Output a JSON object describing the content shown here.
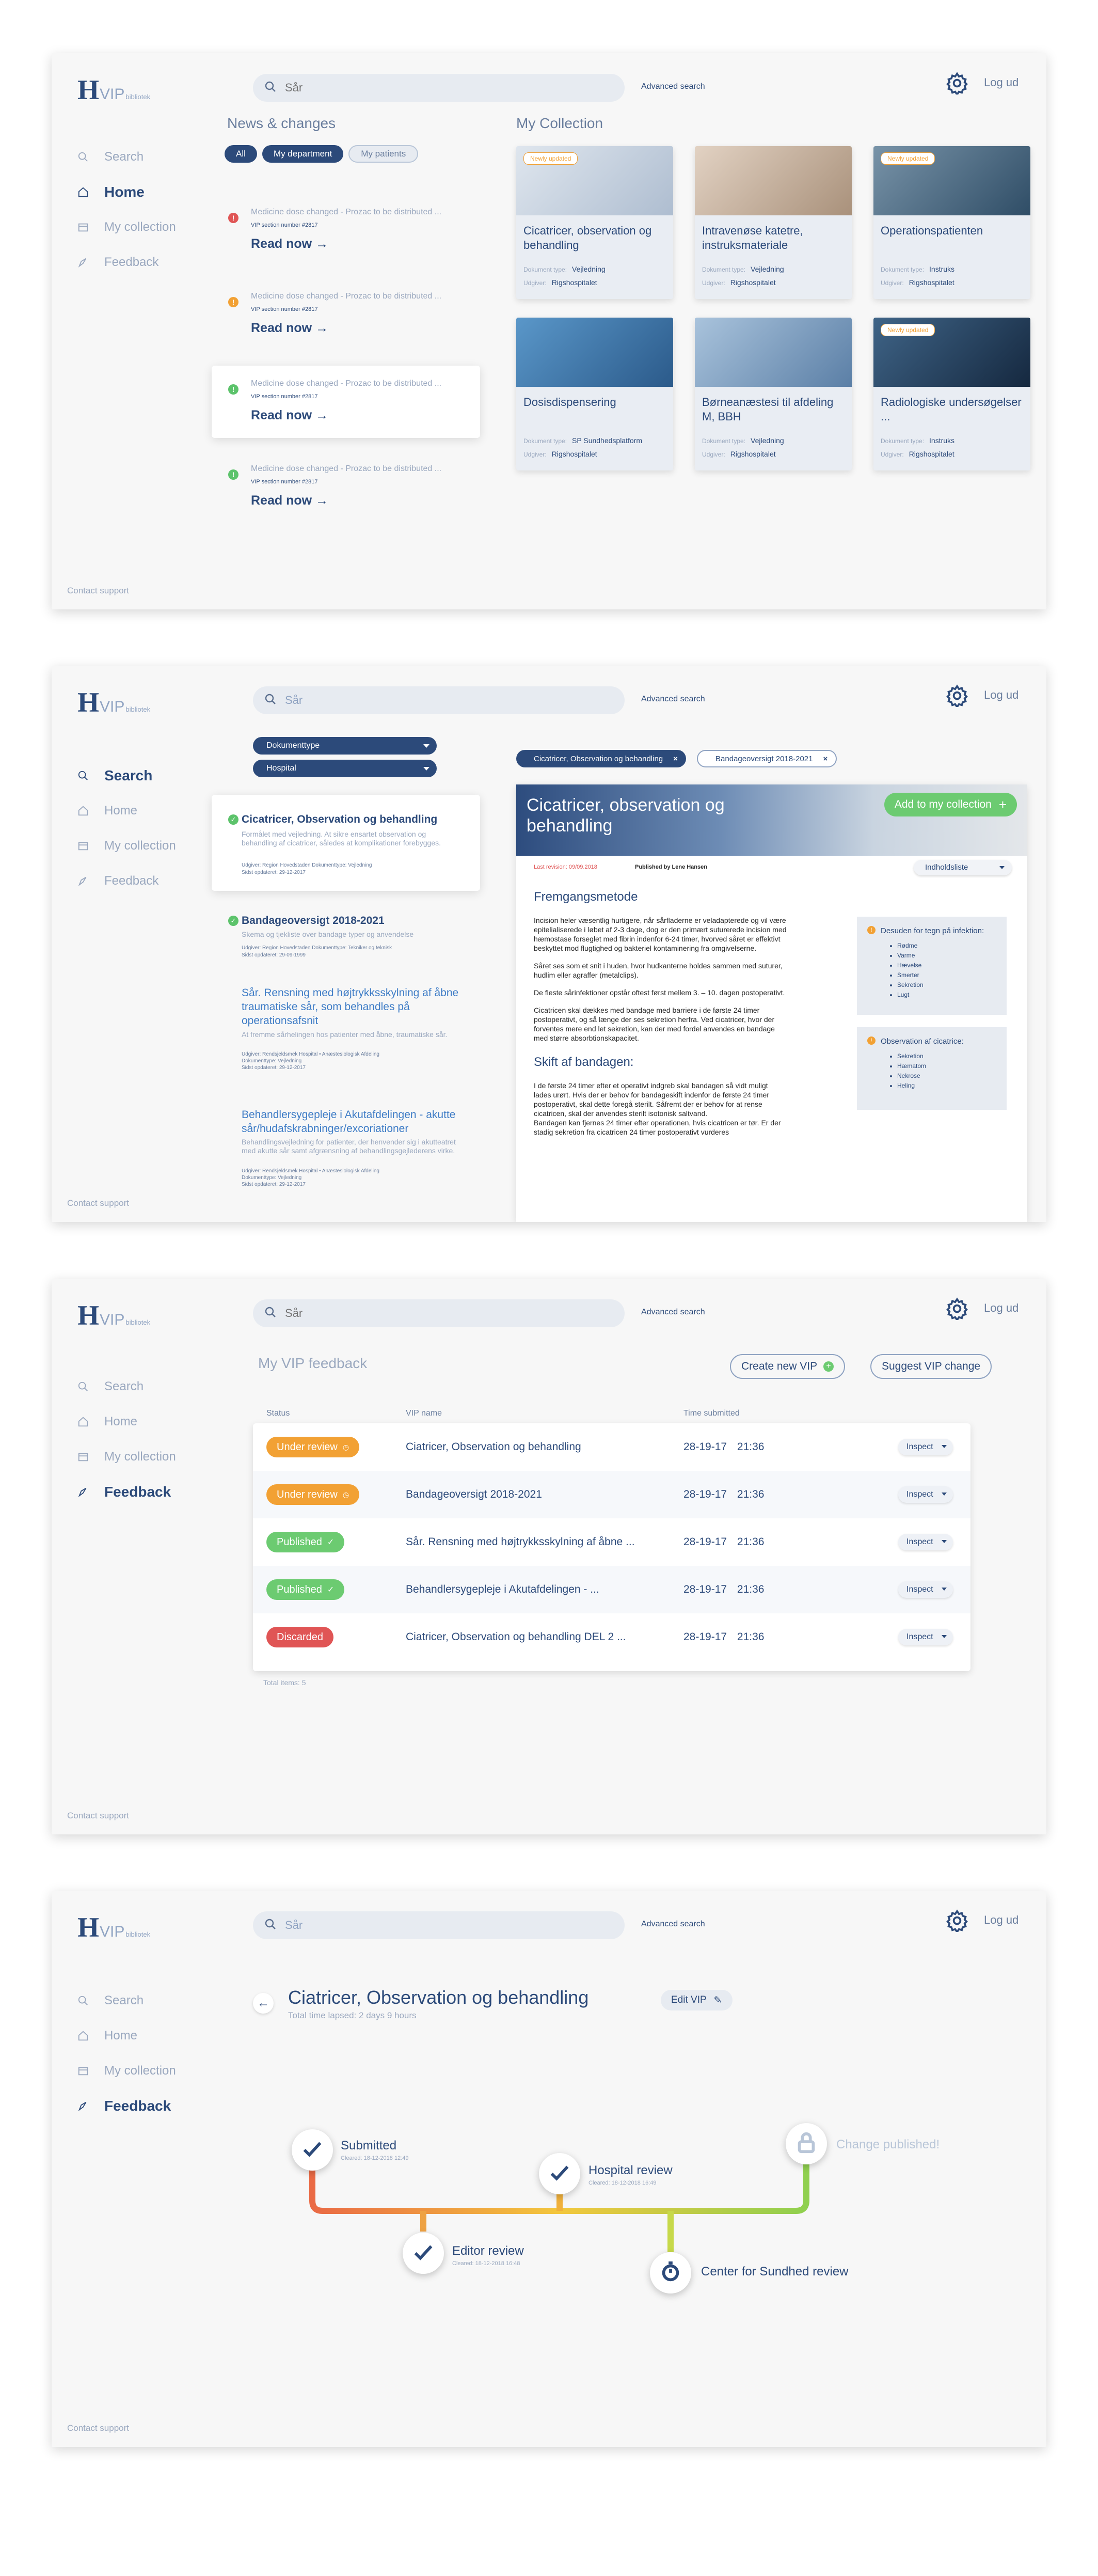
{
  "app": {
    "logo_letter": "H",
    "logo_name": "VIP",
    "logo_sub": "bibliotek",
    "search_placeholder": "Sår",
    "advanced_search": "Advanced search",
    "logout": "Log ud",
    "contact_support": "Contact support",
    "nav": [
      "Search",
      "Home",
      "My collection",
      "Feedback"
    ]
  },
  "home": {
    "news_title": "News & changes",
    "filters": [
      "All",
      "My department",
      "My patients"
    ],
    "news": [
      {
        "text": "Medicine dose changed - Prozac to be distributed ...",
        "version": "VIP section number #2817",
        "cta": "Read now →",
        "level": "!",
        "color": "#e05555"
      },
      {
        "text": "Medicine dose changed - Prozac to be distributed ...",
        "version": "VIP section number #2817",
        "cta": "Read now →",
        "level": "!",
        "color": "#f2a134"
      },
      {
        "text": "Medicine dose changed - Prozac to be distributed ...",
        "version": "VIP section number #2817",
        "cta": "Read now →",
        "level": "!",
        "color": "#5cc36b"
      },
      {
        "text": "Medicine dose changed - Prozac to be distributed ...",
        "version": "VIP section number #2817",
        "cta": "Read now →",
        "level": "!",
        "color": "#5cc36b"
      }
    ],
    "collection_title": "My Collection",
    "cards": [
      {
        "badge": "Newly updated",
        "title": "Cicatricer, observation og behandling",
        "type_label": "Dokument type:",
        "type": "Vejledning",
        "pub_label": "Udgiver:",
        "publisher": "Rigshospitalet",
        "img_color": "#c7d3e0"
      },
      {
        "badge": "",
        "title": "Intravenøse katetre, instruksmateriale",
        "type_label": "Dokument type:",
        "type": "Vejledning",
        "pub_label": "Udgiver:",
        "publisher": "Rigshospitalet",
        "img_color": "#c9b6a3"
      },
      {
        "badge": "Newly updated",
        "title": "Operationspatienten",
        "type_label": "Dokument type:",
        "type": "Instruks",
        "pub_label": "Udgiver:",
        "publisher": "Rigshospitalet",
        "img_color": "#4a6f8c"
      },
      {
        "badge": "",
        "title": "Dosisdispensering",
        "type_label": "Dokument type:",
        "type": "SP Sundhedsplatform",
        "pub_label": "Udgiver:",
        "publisher": "Rigshospitalet",
        "img_color": "#4a82b4"
      },
      {
        "badge": "",
        "title": "Børneanæstesi til afdeling M, BBH",
        "type_label": "Dokument type:",
        "type": "Vejledning",
        "pub_label": "Udgiver:",
        "publisher": "Rigshospitalet",
        "img_color": "#7fa3c4"
      },
      {
        "badge": "Newly updated",
        "title": "Radiologiske undersøgelser ...",
        "type_label": "Dokument type:",
        "type": "Instruks",
        "pub_label": "Udgiver:",
        "publisher": "Rigshospitalet",
        "img_color": "#25405e"
      }
    ]
  },
  "search": {
    "dropdowns": [
      "Dokumenttype",
      "Hospital"
    ],
    "chips": [
      "Cicatricer, Observation og behandling",
      "Bandageoversigt 2018-2021"
    ],
    "results": [
      {
        "title": "Cicatricer, Observation og behandling",
        "desc": "Formålet med vejledning. At sikre ensartet observation og behandling af cicatricer, således at komplikationer forebygges.",
        "meta1": "Udgiver: Region Hovedstaden      Dokumenttype: Vejledning",
        "meta2": "Sidst opdateret: 29-12-2017"
      },
      {
        "title": "Bandageoversigt 2018-2021",
        "desc": "Skema og tjekliste over bandage typer og anvendelse",
        "meta1": "Udgiver: Region Hovedstaden      Dokumenttype: Tekniker og teknisk",
        "meta2": "Sidst opdateret: 29-09-1999"
      },
      {
        "title": "Sår. Rensning med højtrykksskylning af åbne traumatiske sår, som behandles på operationsafsnit",
        "desc": "At fremme sårhelingen hos patienter med åbne, traumatiske sår.",
        "meta1": "Udgiver: Rendsjeldsmek Hospital • Anæstesiologisk Afdeling",
        "meta2": "Dokumenttype: Vejledning",
        "meta3": "Sidst opdateret: 29-12-2017"
      },
      {
        "title": "Behandlersygepleje i Akutafdelingen - akutte sår/hudafskrabninger/excoriationer",
        "desc": "Behandlingsvejledning for patienter, der henvender sig i akutteatret med akutte sår samt afgrænsning af behandlingsgejlederens virke.",
        "meta1": "Udgiver: Rendsjeldsmek Hospital • Anæstesiologisk Afdeling",
        "meta2": "Dokumenttype: Vejledning",
        "meta3": "Sidst opdateret: 29-12-2017"
      }
    ],
    "doc": {
      "title": "Cicatricer, observation og behandling",
      "add_btn": "Add to my collection",
      "last_revision": "Last revision: 09/09.2018",
      "published_by": "Published by Lene Hansen",
      "toc": "Indholdsliste",
      "h1": "Fremgangsmetode",
      "p1": "Incision heler væsentlig hurtigere, når sårfladerne er veladapterede og vil være epitelialiserede i løbet af 2-3 dage, dog er den primært suturerede incision med hæmostase forseglet med fibrin indenfor 6-24 timer, hvorved såret er effektivt beskyttet mod flugtighed og bakteriel kontaminering fra omgivelserne.",
      "p2": "Såret ses som et snit i huden, hvor hudkanterne holdes sammen med suturer, hudlim eller agraffer (metalclips).",
      "p3": "De fleste sårinfektioner opstår oftest først mellem 3. – 10. dagen postoperativt.",
      "p4": "Cicatricen skal dækkes med bandage med barriere i de første 24 timer postoperativt, og så længe der ses sekretion herfra. Ved cicatricer, hvor der forventes mere end let sekretion, kan der med fordel anvendes en bandage med større absorbtionskapacitet.",
      "h2": "Skift af bandagen:",
      "p5": "I de første 24 timer efter et operativt indgreb skal bandagen så vidt muligt lades urørt. Hvis der er behov for bandageskift indenfor de første 24 timer postoperativt, skal dette foregå sterilt. Såfremt der er behov for at rense cicatricen, skal der anvendes sterilt isotonisk saltvand.\nBandagen kan fjernes 24 timer efter operationen, hvis cicatricen er tør. Er der stadig sekretion fra cicatricen 24 timer postoperativt vurderes",
      "box1_title": "Desuden for tegn på infektion:",
      "box1_items": [
        "Rødme",
        "Varme",
        "Hævelse",
        "Smerter",
        "Sekretion",
        "Lugt"
      ],
      "box2_title": "Observation af cicatrice:",
      "box2_items": [
        "Sekretion",
        "Hæmatom",
        "Nekrose",
        "Heling"
      ]
    }
  },
  "feedback": {
    "title": "My VIP feedback",
    "btn_new": "Create new VIP",
    "btn_suggest": "Suggest VIP change",
    "cols": [
      "Status",
      "VIP name",
      "Time submitted"
    ],
    "rows": [
      {
        "status": "Under review",
        "status_color": "#f2a134",
        "name": "Ciatricer, Observation og behandling",
        "time": "28-19-17 21:36",
        "action": "Inspect"
      },
      {
        "status": "Under review",
        "status_color": "#f2a134",
        "name": "Bandageoversigt 2018-2021",
        "time": "28-19-17 21:36",
        "action": "Inspect"
      },
      {
        "status": "Published",
        "status_color": "#6ccb71",
        "name": "Sår. Rensning med højtrykksskylning af åbne ...",
        "time": "28-19-17 21:36",
        "action": "Inspect"
      },
      {
        "status": "Published",
        "status_color": "#6ccb71",
        "name": "Behandlersygepleje i Akutafdelingen - ...",
        "time": "28-19-17 21:36",
        "action": "Inspect"
      },
      {
        "status": "Discarded",
        "status_color": "#e05555",
        "name": "Ciatricer, Observation og behandling DEL 2 ...",
        "time": "28-19-17 21:36",
        "action": "Inspect"
      }
    ],
    "total": "Total items: 5"
  },
  "detail": {
    "title": "Ciatricer, Observation og behandling",
    "edit": "Edit VIP",
    "lapsed": "Total time lapsed: 2 days 9 hours",
    "steps": [
      {
        "label": "Submitted",
        "sub": "Cleared: 18-12-2018 12:49"
      },
      {
        "label": "Hospital review",
        "sub": "Cleared: 18-12-2018 16:49"
      },
      {
        "label": "Change published!",
        "sub": ""
      },
      {
        "label": "Editor review",
        "sub": "Cleared: 18-12-2018 16:48"
      },
      {
        "label": "Center for Sundhed review",
        "sub": ""
      }
    ]
  }
}
